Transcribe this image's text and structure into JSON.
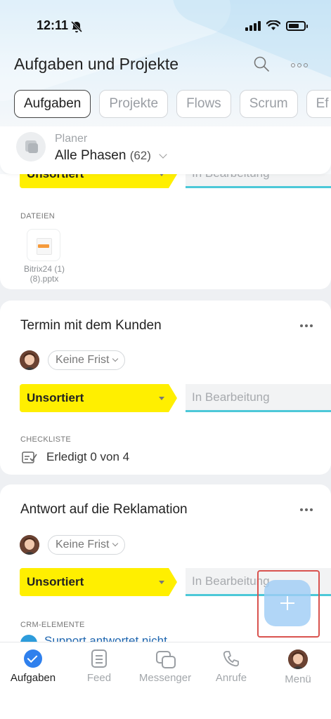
{
  "status_bar": {
    "time": "12:11"
  },
  "header": {
    "title": "Aufgaben und Projekte",
    "tabs": [
      {
        "label": "Aufgaben",
        "active": true
      },
      {
        "label": "Projekte"
      },
      {
        "label": "Flows"
      },
      {
        "label": "Scrum"
      },
      {
        "label": "Ef"
      }
    ],
    "planer": {
      "label": "Planer",
      "value": "Alle Phasen",
      "count": "(62)"
    }
  },
  "cards": [
    {
      "stage": "Unsortiert",
      "next_stage": "In Bearbeitung",
      "section_label": "DATEIEN",
      "file_name": "Bitrix24 (1) (8).pptx"
    },
    {
      "title": "Termin mit dem Kunden",
      "deadline": "Keine Frist",
      "stage": "Unsortiert",
      "next_stage": "In Bearbeitung",
      "section_label": "CHECKLISTE",
      "checklist": "Erledigt 0 von 4"
    },
    {
      "title": "Antwort auf die Reklamation",
      "deadline": "Keine Frist",
      "stage": "Unsortiert",
      "next_stage": "In Bearbeitung",
      "section_label": "CRM-ELEMENTE",
      "crm_item": "Support antwortet nicht"
    }
  ],
  "bottom_nav": [
    {
      "label": "Aufgaben",
      "icon": "check-circle-icon",
      "active": true
    },
    {
      "label": "Feed",
      "icon": "feed-icon"
    },
    {
      "label": "Messenger",
      "icon": "messenger-icon"
    },
    {
      "label": "Anrufe",
      "icon": "phone-icon"
    },
    {
      "label": "Menü",
      "icon": "avatar-icon"
    }
  ],
  "colors": {
    "stage_yellow": "#ffef00",
    "stage_next_underline": "#4cc8d8",
    "accent_blue": "#2f80ed",
    "fab": "#a0cdf5",
    "highlight_red": "#d9534f"
  }
}
